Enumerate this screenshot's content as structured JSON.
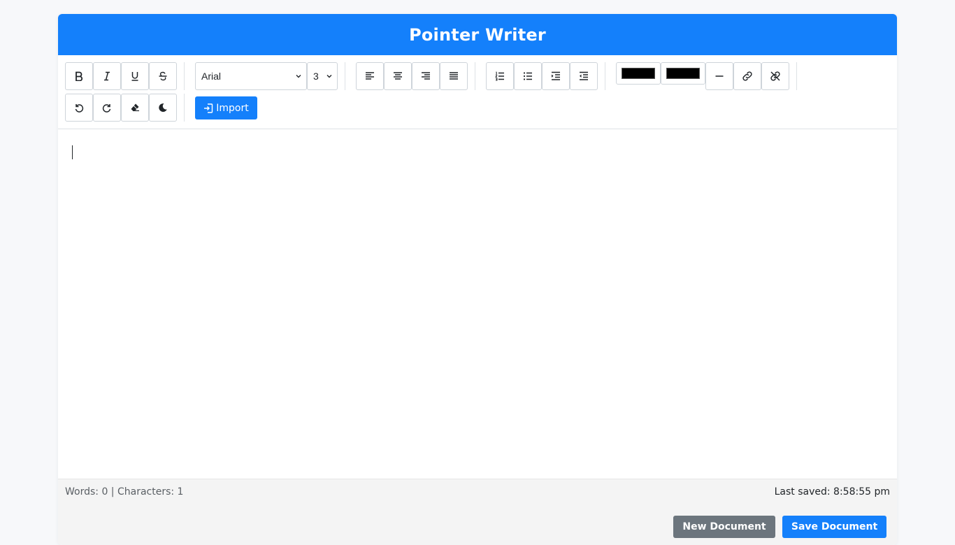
{
  "app": {
    "title": "Pointer Writer"
  },
  "toolbar": {
    "font_family": "Arial",
    "font_size": "3",
    "text_color": "#000000",
    "highlight_color": "#000000",
    "import_label": "Import",
    "icons": [
      "bold-icon",
      "italic-icon",
      "underline-icon",
      "strikethrough-icon",
      "align-left-icon",
      "align-center-icon",
      "align-right-icon",
      "justify-icon",
      "ordered-list-icon",
      "unordered-list-icon",
      "indent-icon",
      "outdent-icon",
      "horizontal-rule-icon",
      "link-icon",
      "unlink-icon",
      "undo-icon",
      "redo-icon",
      "eraser-icon",
      "moon-icon",
      "import-icon"
    ]
  },
  "editor": {
    "content": ""
  },
  "status": {
    "counts": "Words: 0 | Characters: 1",
    "last_saved": "Last saved: 8:58:55 pm"
  },
  "actions": {
    "new_document": "New Document",
    "save_document": "Save Document"
  },
  "colors": {
    "accent": "#1480fb",
    "secondary": "#6c757d"
  }
}
